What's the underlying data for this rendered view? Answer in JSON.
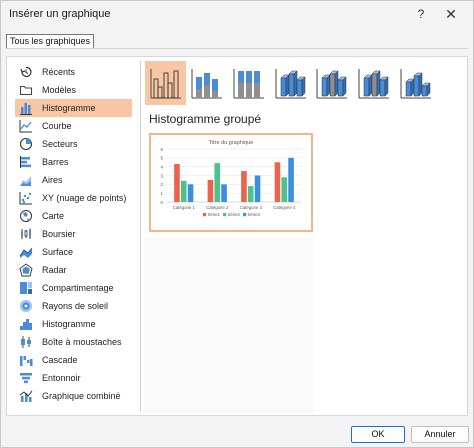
{
  "window": {
    "title": "Insérer un graphique",
    "help_glyph": "?",
    "close_glyph": "✕"
  },
  "tab": {
    "label": "Tous les graphiques"
  },
  "sidebar": {
    "items": [
      {
        "label": "Récents",
        "icon": "recent-icon"
      },
      {
        "label": "Modèles",
        "icon": "folder-icon"
      },
      {
        "label": "Histogramme",
        "icon": "column-chart-icon",
        "active": true
      },
      {
        "label": "Courbe",
        "icon": "line-chart-icon"
      },
      {
        "label": "Secteurs",
        "icon": "pie-chart-icon"
      },
      {
        "label": "Barres",
        "icon": "bar-chart-icon"
      },
      {
        "label": "Aires",
        "icon": "area-chart-icon"
      },
      {
        "label": "XY (nuage de points)",
        "icon": "scatter-chart-icon"
      },
      {
        "label": "Carte",
        "icon": "map-chart-icon"
      },
      {
        "label": "Boursier",
        "icon": "stock-chart-icon"
      },
      {
        "label": "Surface",
        "icon": "surface-chart-icon"
      },
      {
        "label": "Radar",
        "icon": "radar-chart-icon"
      },
      {
        "label": "Compartimentage",
        "icon": "treemap-chart-icon"
      },
      {
        "label": "Rayons de soleil",
        "icon": "sunburst-chart-icon"
      },
      {
        "label": "Histogramme",
        "icon": "histogram-chart-icon"
      },
      {
        "label": "Boîte à moustaches",
        "icon": "boxplot-chart-icon"
      },
      {
        "label": "Cascade",
        "icon": "waterfall-chart-icon"
      },
      {
        "label": "Entonnoir",
        "icon": "funnel-chart-icon"
      },
      {
        "label": "Graphique combiné",
        "icon": "combo-chart-icon"
      }
    ]
  },
  "subtypes": [
    {
      "name": "clustered-column",
      "active": true
    },
    {
      "name": "stacked-column"
    },
    {
      "name": "100-stacked-column"
    },
    {
      "name": "3d-clustered-column"
    },
    {
      "name": "3d-stacked-column"
    },
    {
      "name": "3d-100-stacked-column"
    },
    {
      "name": "3d-column"
    }
  ],
  "selected_subtype_name": "Histogramme groupé",
  "colors": {
    "accent_selection": "#f8c6a4",
    "preview_border": "#f5b58c",
    "chart_blue": "#4a8cd6",
    "series1": "#e8644c",
    "series2": "#4cc28c",
    "series3": "#3c8ee0"
  },
  "chart_data": {
    "type": "bar",
    "title": "Titre du graphique",
    "categories": [
      "Catégorie 1",
      "Catégorie 2",
      "Catégorie 3",
      "Catégorie 4"
    ],
    "series": [
      {
        "name": "Série1",
        "values": [
          4.3,
          2.5,
          3.5,
          4.5
        ]
      },
      {
        "name": "Série2",
        "values": [
          2.4,
          4.4,
          1.8,
          2.8
        ]
      },
      {
        "name": "Série3",
        "values": [
          2,
          2,
          3,
          5
        ]
      }
    ],
    "ylim": [
      0,
      6
    ],
    "yticks": [
      "0",
      "1",
      "2",
      "3",
      "4",
      "5",
      "6"
    ],
    "grid": true,
    "legend": "bottom"
  },
  "buttons": {
    "ok": "OK",
    "cancel": "Annuler"
  }
}
